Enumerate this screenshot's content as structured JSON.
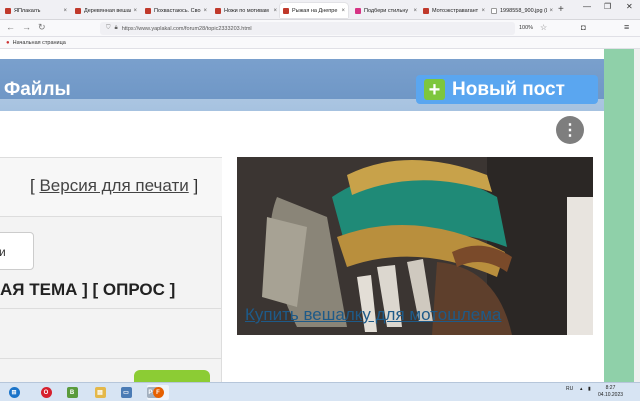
{
  "browser": {
    "tabs": [
      {
        "label": "ЯПлакалъ",
        "favicon_color": "#c0392b"
      },
      {
        "label": "Деревянная вешал",
        "favicon_color": "#c0392b"
      },
      {
        "label": "Похвастаюсь. Сво",
        "favicon_color": "#c0392b"
      },
      {
        "label": "Ножи по мотивам",
        "favicon_color": "#c0392b"
      },
      {
        "label": "Рыжая на Днепре",
        "favicon_color": "#c0392b"
      },
      {
        "label": "Подбери стильну",
        "favicon_color": "#d63384"
      },
      {
        "label": "Мотоэкстравагант",
        "favicon_color": "#c0392b"
      },
      {
        "label": "1998558_900.jpg (Изо",
        "favicon_color": "#ffffff"
      }
    ],
    "active_tab": 4,
    "new_tab_symbol": "+",
    "window_controls": {
      "minimize": "—",
      "maximize": "❐",
      "close": "✕"
    },
    "url": "https://www.yaplakal.com/forum28/topic2333203.html",
    "zoom": "100%",
    "bookmark": "Начальная страница"
  },
  "page": {
    "title": "Файлы",
    "new_post_label": "Новый пост",
    "print_open": "[",
    "print_link": "Версия для печати",
    "print_close": "]",
    "stub_button": "и",
    "topic_links": "АЯ ТЕМА ] [ ОПРОС ]",
    "ad_link": "Купить вешалку для мотошлема",
    "ad_menu": "⋮"
  },
  "taskbar": {
    "items": [
      {
        "name": "start",
        "glyph": "⊞",
        "color": "#1b74c9"
      },
      {
        "name": "opera",
        "glyph": "O",
        "color": "#d6202d"
      },
      {
        "name": "bluestacks",
        "glyph": "B",
        "color": "#5a9b3c"
      },
      {
        "name": "explorer",
        "glyph": "▤",
        "color": "#e4b84a"
      },
      {
        "name": "monitor",
        "glyph": "▭",
        "color": "#4a7bb5"
      },
      {
        "name": "photoshop",
        "glyph": "Ps",
        "color": "#1b3a5f"
      },
      {
        "name": "firefox",
        "glyph": "F",
        "color": "#e66000"
      }
    ],
    "lang": "RU",
    "time": "8:27",
    "date": "04.10.2023"
  },
  "colors": {
    "header_blue": "#6f97c6",
    "new_post_blue": "#5aa6f0",
    "plus_green": "#7dc63d",
    "side_green": "#8fd0a9",
    "link_blue": "#1e5a88"
  }
}
